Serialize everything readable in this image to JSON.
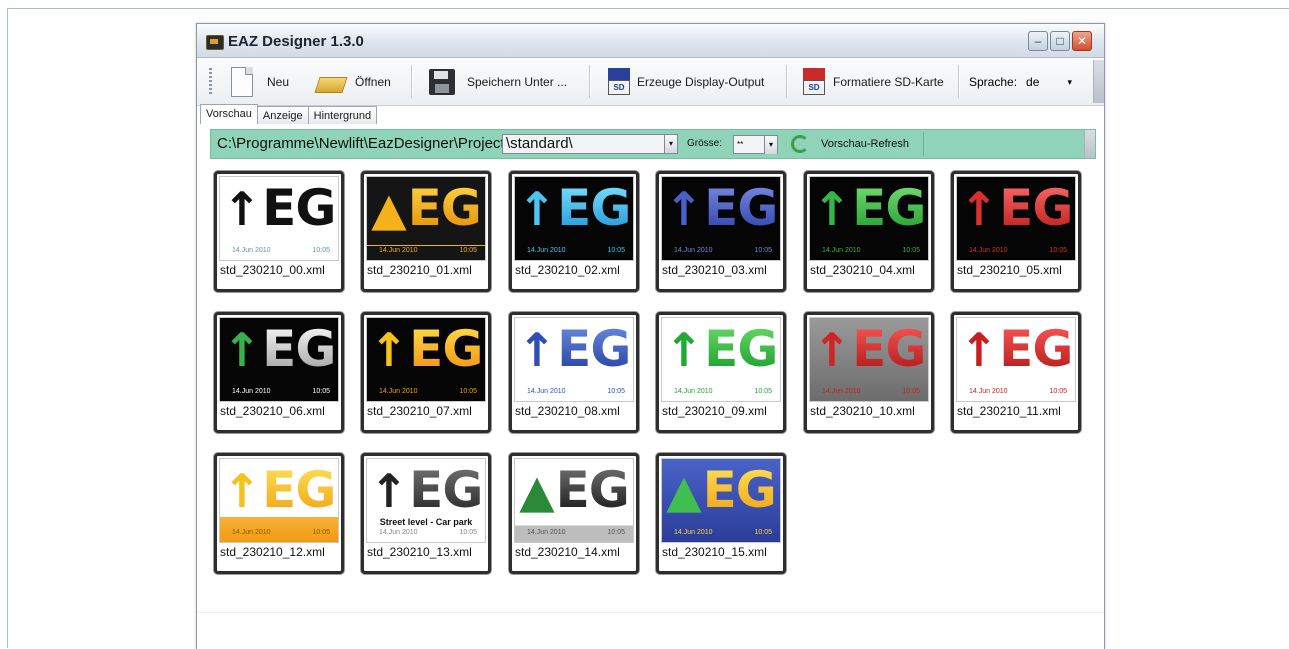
{
  "window": {
    "title": "EAZ Designer 1.3.0",
    "controls": {
      "minimize": "–",
      "maximize": "□",
      "close": "✕"
    }
  },
  "toolbar": {
    "new_label": "Neu",
    "open_label": "Öffnen",
    "save_as_label": "Speichern Unter ...",
    "display_output_label": "Erzeuge Display-Output",
    "format_sd_label": "Formatiere SD-Karte",
    "sd_icon_text": "SD",
    "language_label": "Sprache:",
    "language_value": "de",
    "dropdown_glyph": "▾"
  },
  "tabs": [
    "Vorschau",
    "Anzeige",
    "Hintergrund"
  ],
  "pathbar": {
    "path": "C:\\Programme\\Newlift\\EazDesigner\\Projects",
    "folder_value": "\\standard\\",
    "size_label": "Grösse:",
    "size_value": "**",
    "refresh_label": "Vorschau-Refresh"
  },
  "tiles": [
    {
      "file": "std_230210_00.xml",
      "date": "14.Jun 2010",
      "time": "10:05"
    },
    {
      "file": "std_230210_01.xml",
      "date": "14.Jun 2010",
      "time": "10:05"
    },
    {
      "file": "std_230210_02.xml",
      "date": "14.Jun 2010",
      "time": "10:05"
    },
    {
      "file": "std_230210_03.xml",
      "date": "14.Jun 2010",
      "time": "10:05"
    },
    {
      "file": "std_230210_04.xml",
      "date": "14.Jun 2010",
      "time": "10:05"
    },
    {
      "file": "std_230210_05.xml",
      "date": "14.Jun 2010",
      "time": "10:05"
    },
    {
      "file": "std_230210_06.xml",
      "date": "14.Jun 2010",
      "time": "10:05"
    },
    {
      "file": "std_230210_07.xml",
      "date": "14.Jun 2010",
      "time": "10:05"
    },
    {
      "file": "std_230210_08.xml",
      "date": "14.Jun 2010",
      "time": "10:05"
    },
    {
      "file": "std_230210_09.xml",
      "date": "14.Jun 2010",
      "time": "10:05"
    },
    {
      "file": "std_230210_10.xml",
      "date": "14.Jun 2010",
      "time": "10:05"
    },
    {
      "file": "std_230210_11.xml",
      "date": "14.Jun 2010",
      "time": "10:05"
    },
    {
      "file": "std_230210_12.xml",
      "date": "14.Jun 2010",
      "time": "10:05"
    },
    {
      "file": "std_230210_13.xml",
      "date": "14.Jun 2010",
      "time": "10:05",
      "street": "Street level - Car park"
    },
    {
      "file": "std_230210_14.xml",
      "date": "14.Jun 2010",
      "time": "10:05"
    },
    {
      "file": "std_230210_15.xml",
      "date": "14.Jun 2010",
      "time": "10:05"
    }
  ],
  "display_text": "EG",
  "colors": {
    "accent_pathbar": "#8fd3b9",
    "tile_border": "#2e2e2e"
  }
}
